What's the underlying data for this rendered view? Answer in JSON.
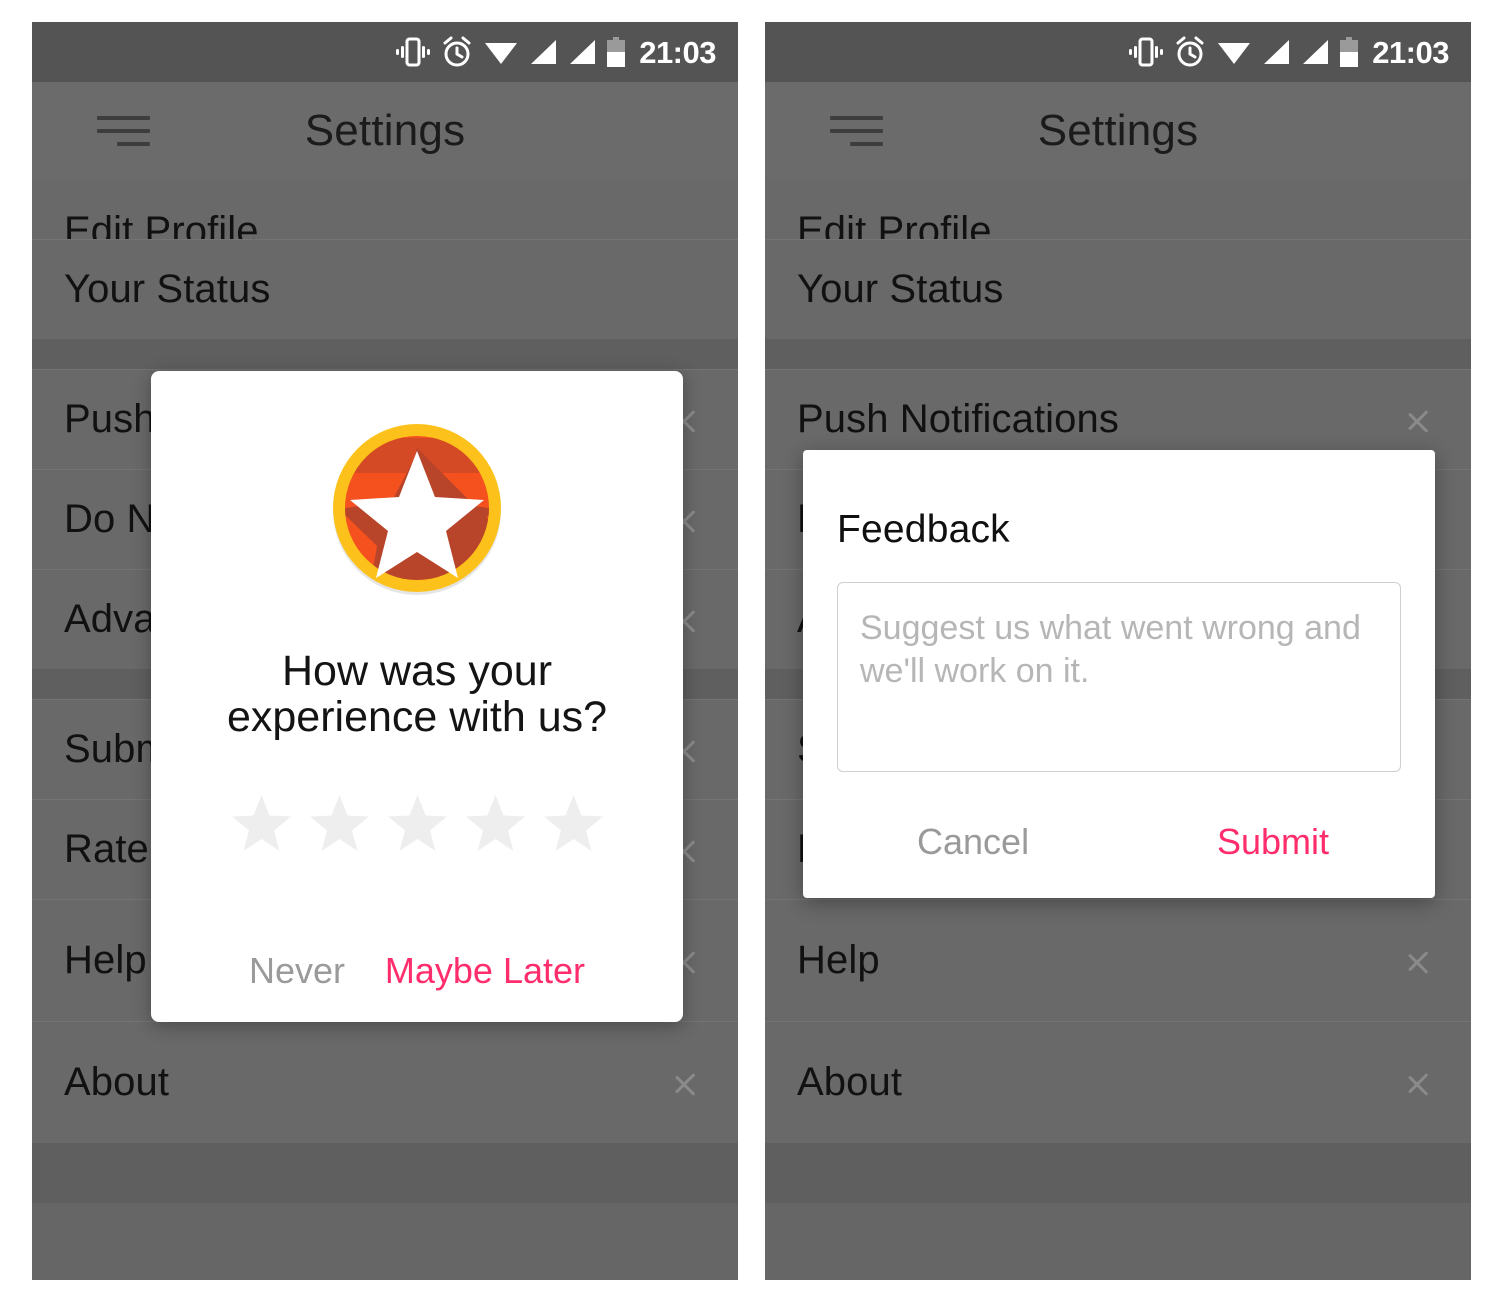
{
  "statusbar": {
    "time": "21:03",
    "icons": [
      "vibrate-icon",
      "alarm-icon",
      "wifi-icon",
      "signal-icon",
      "signal-icon",
      "battery-icon"
    ]
  },
  "toolbar": {
    "title": "Settings",
    "menu_icon": "hamburger-menu-icon"
  },
  "settings": {
    "sections": [
      {
        "rows": [
          {
            "label": "Edit Profile",
            "chevron": false
          },
          {
            "label": "Your Status",
            "chevron": false
          }
        ]
      },
      {
        "rows": [
          {
            "label": "Push Notifications",
            "chevron": true
          },
          {
            "label": "Do Not Disturb",
            "chevron": true
          },
          {
            "label": "Advanced",
            "chevron": true
          }
        ]
      },
      {
        "rows": [
          {
            "label": "Submit Feedback",
            "chevron": true
          },
          {
            "label": "Rate Us",
            "chevron": true
          },
          {
            "label": "Help",
            "chevron": true
          },
          {
            "label": "About",
            "chevron": true
          }
        ]
      }
    ],
    "left_panel_rows": [
      {
        "label": "Edit Profile",
        "chevron": false
      },
      {
        "label": "Your Status",
        "chevron": false
      },
      {
        "label": "Push Notifications",
        "chevron": true
      },
      {
        "label": "Do Not Disturb",
        "chevron": true
      },
      {
        "label": "Advanced",
        "chevron": true
      },
      {
        "label": "Submit Feedback",
        "chevron": true
      },
      {
        "label": "Rate Us",
        "chevron": true
      },
      {
        "label": "Help",
        "chevron": true
      },
      {
        "label": "About",
        "chevron": true
      }
    ]
  },
  "rate_dialog": {
    "badge_icon": "star-badge-icon",
    "title": "How was your experience with us?",
    "star_count": 5,
    "stars_selected": 0,
    "never_label": "Never",
    "maybe_later_label": "Maybe Later"
  },
  "feedback_dialog": {
    "title": "Feedback",
    "placeholder": "Suggest us what went wrong and we'll work on it.",
    "value": "",
    "cancel_label": "Cancel",
    "submit_label": "Submit"
  },
  "colors": {
    "accent_pink": "#ff2d6b",
    "muted_gray": "#9a9a9a",
    "badge_ring": "#fcc21b",
    "badge_face": "#f4511e",
    "badge_shadow": "#b8452a",
    "star_empty": "#eeeeee",
    "scrim": "#666666",
    "statusbar": "#545454",
    "toolbar": "#6b6b6b"
  }
}
